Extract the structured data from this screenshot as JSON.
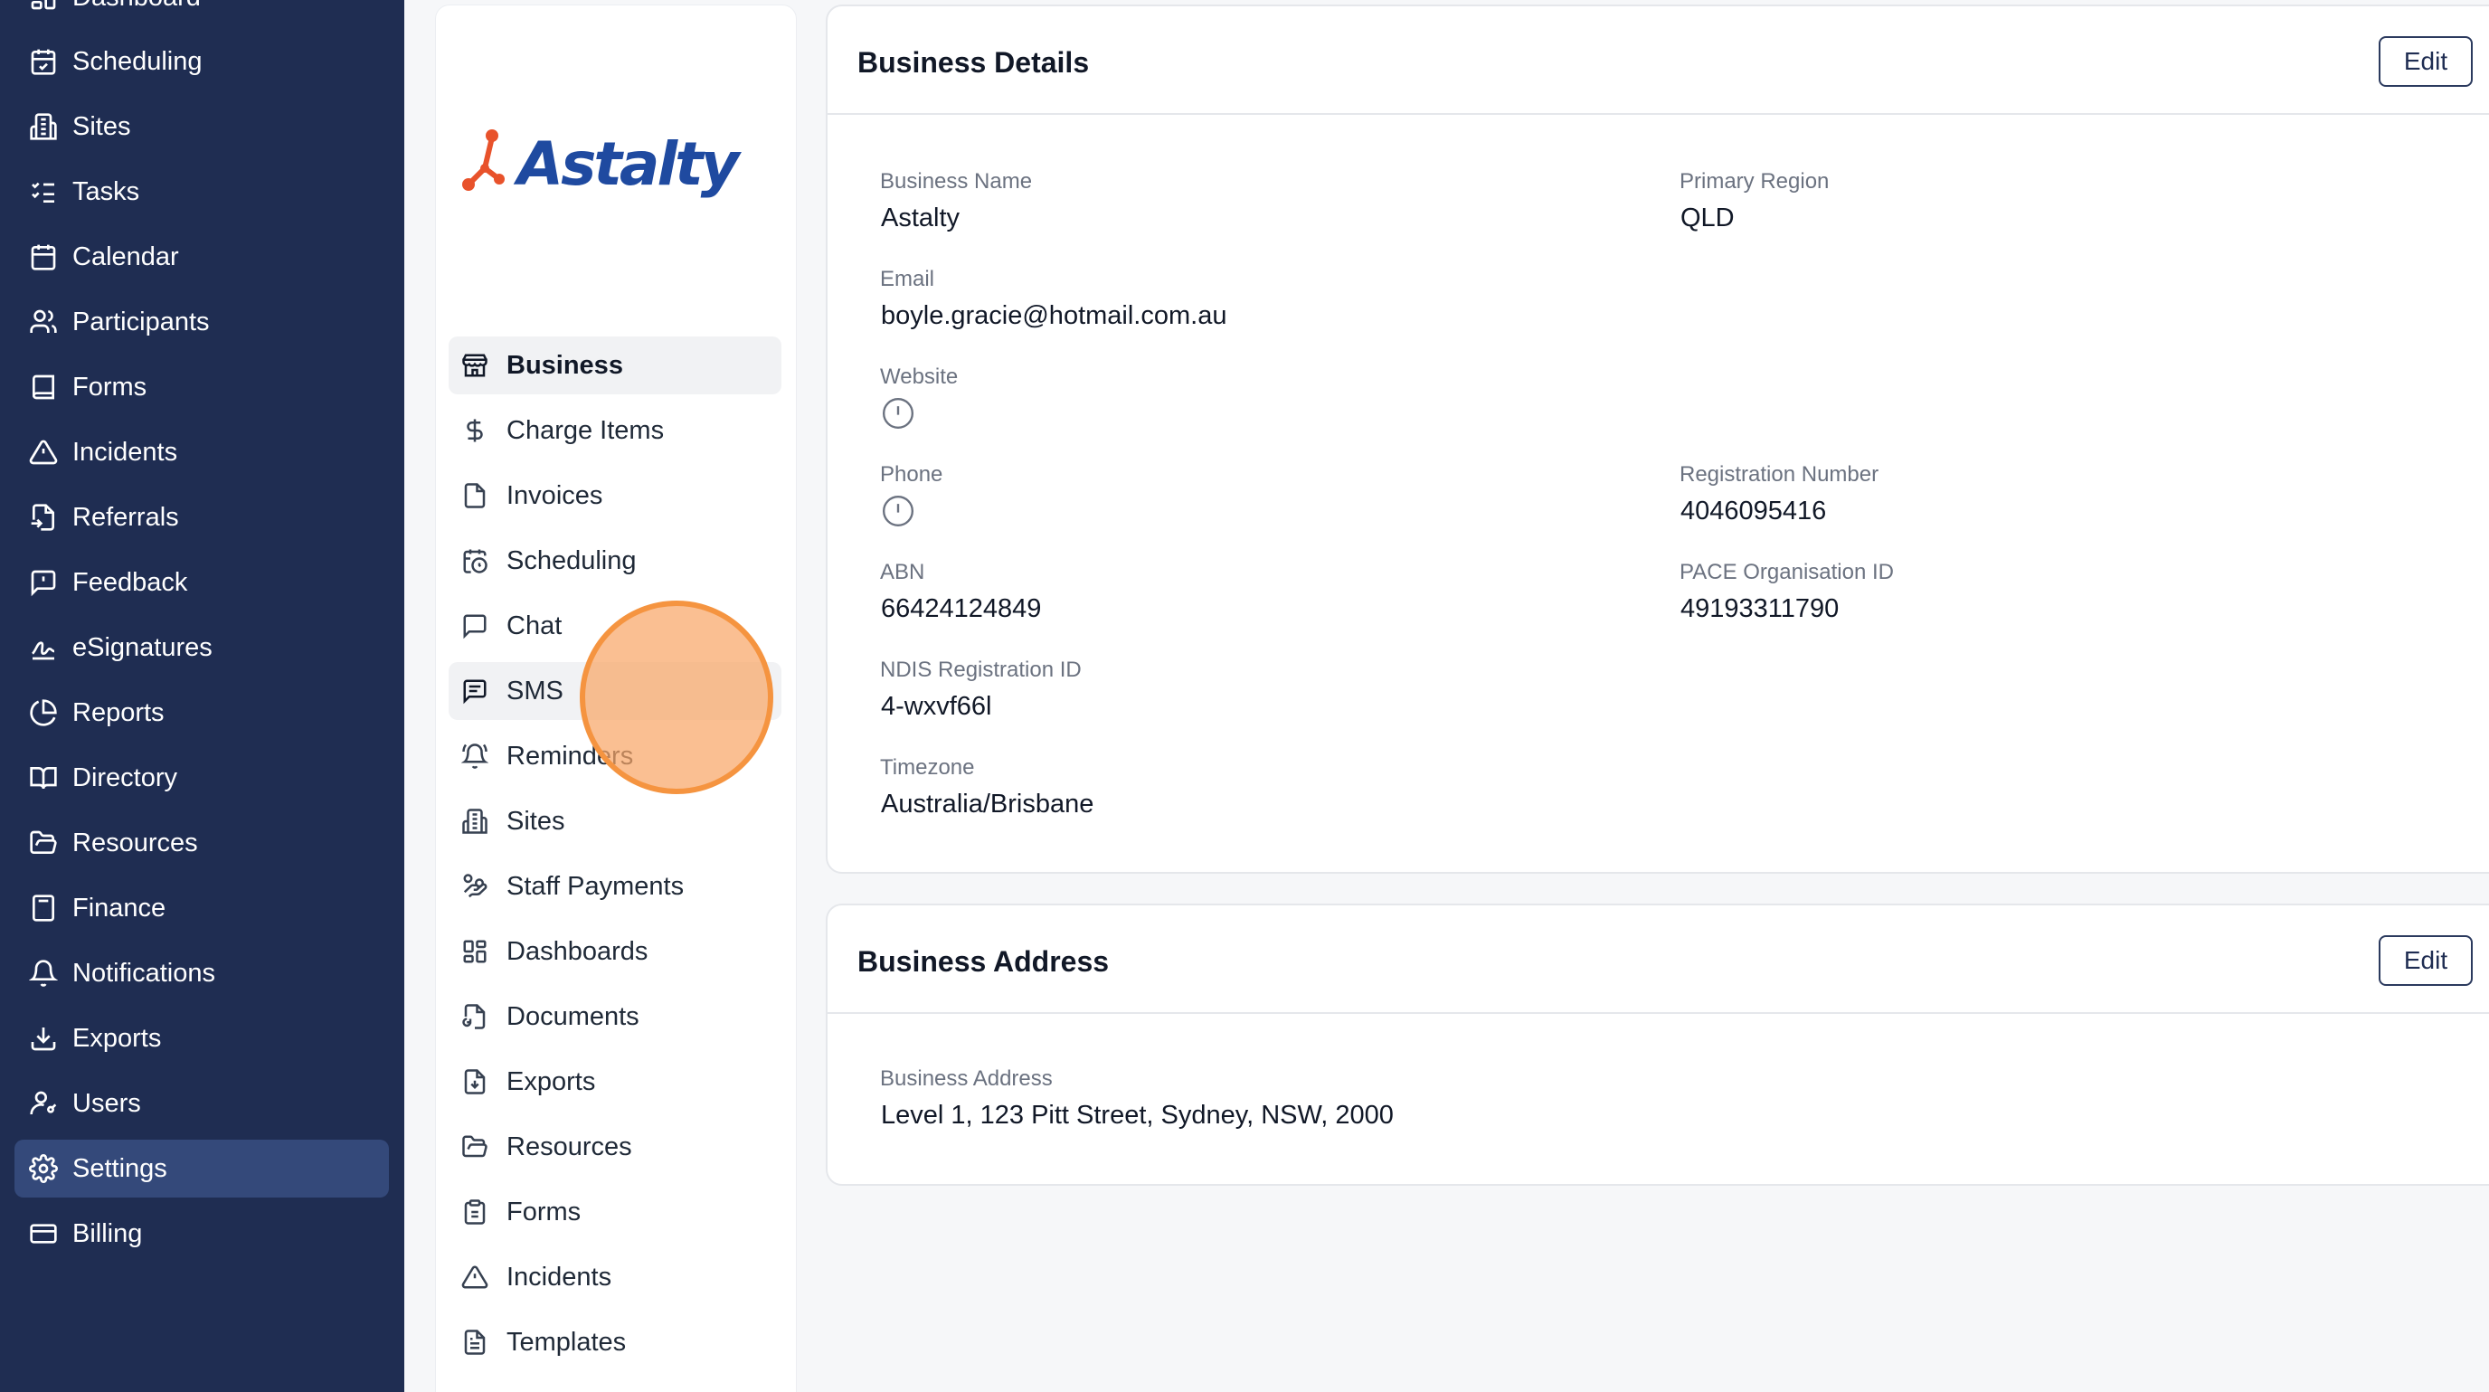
{
  "sidebar": {
    "items": [
      {
        "label": "Dashboard",
        "icon": "dashboard-icon"
      },
      {
        "label": "Scheduling",
        "icon": "calendar-check-icon"
      },
      {
        "label": "Sites",
        "icon": "building-icon"
      },
      {
        "label": "Tasks",
        "icon": "list-checks-icon"
      },
      {
        "label": "Calendar",
        "icon": "calendar-icon"
      },
      {
        "label": "Participants",
        "icon": "users-icon"
      },
      {
        "label": "Forms",
        "icon": "book-icon"
      },
      {
        "label": "Incidents",
        "icon": "warning-triangle-icon"
      },
      {
        "label": "Referrals",
        "icon": "file-import-icon"
      },
      {
        "label": "Feedback",
        "icon": "message-alert-icon"
      },
      {
        "label": "eSignatures",
        "icon": "signature-icon"
      },
      {
        "label": "Reports",
        "icon": "pie-chart-icon"
      },
      {
        "label": "Directory",
        "icon": "book-open-icon"
      },
      {
        "label": "Resources",
        "icon": "folder-open-icon"
      },
      {
        "label": "Finance",
        "icon": "calculator-icon"
      },
      {
        "label": "Notifications",
        "icon": "bell-icon"
      },
      {
        "label": "Exports",
        "icon": "download-icon"
      },
      {
        "label": "Users",
        "icon": "user-key-icon"
      },
      {
        "label": "Settings",
        "icon": "gear-icon",
        "active": true
      },
      {
        "label": "Billing",
        "icon": "credit-card-icon"
      }
    ]
  },
  "settings_nav": {
    "logo_text": "Astalty",
    "items": [
      {
        "label": "Business",
        "icon": "store-icon",
        "active": true
      },
      {
        "label": "Charge Items",
        "icon": "dollar-icon"
      },
      {
        "label": "Invoices",
        "icon": "file-icon"
      },
      {
        "label": "Scheduling",
        "icon": "calendar-clock-icon"
      },
      {
        "label": "Chat",
        "icon": "chat-icon"
      },
      {
        "label": "SMS",
        "icon": "message-text-icon"
      },
      {
        "label": "Reminders",
        "icon": "bell-ring-icon"
      },
      {
        "label": "Sites",
        "icon": "building-icon"
      },
      {
        "label": "Staff Payments",
        "icon": "hand-coins-icon"
      },
      {
        "label": "Dashboards",
        "icon": "dashboard-icon"
      },
      {
        "label": "Documents",
        "icon": "file-sync-icon"
      },
      {
        "label": "Exports",
        "icon": "file-download-icon"
      },
      {
        "label": "Resources",
        "icon": "folder-open-icon"
      },
      {
        "label": "Forms",
        "icon": "clipboard-icon"
      },
      {
        "label": "Incidents",
        "icon": "warning-triangle-icon"
      },
      {
        "label": "Templates",
        "icon": "file-text-icon"
      }
    ]
  },
  "business_details": {
    "title": "Business Details",
    "edit_label": "Edit",
    "fields": {
      "business_name": {
        "label": "Business Name",
        "value": "Astalty"
      },
      "primary_region": {
        "label": "Primary Region",
        "value": "QLD"
      },
      "email": {
        "label": "Email",
        "value": "boyle.gracie@hotmail.com.au"
      },
      "website": {
        "label": "Website",
        "icon": "info-circle-icon"
      },
      "phone": {
        "label": "Phone",
        "icon": "info-circle-icon"
      },
      "registration_number": {
        "label": "Registration Number",
        "value": "4046095416"
      },
      "abn": {
        "label": "ABN",
        "value": "66424124849"
      },
      "pace_id": {
        "label": "PACE Organisation ID",
        "value": "49193311790"
      },
      "ndis_id": {
        "label": "NDIS Registration ID",
        "value": "4-wxvf66l"
      },
      "timezone": {
        "label": "Timezone",
        "value": "Australia/Brisbane"
      }
    }
  },
  "business_address": {
    "title": "Business Address",
    "edit_label": "Edit",
    "address": {
      "label": "Business Address",
      "value": "Level 1, 123 Pitt Street, Sydney, NSW, 2000"
    }
  },
  "colors": {
    "sidebar_bg": "#1f2d52",
    "sidebar_active": "#34497a",
    "logo_orange": "#e8522b",
    "logo_blue": "#1f4aa0",
    "click_indicator": "#f59440"
  }
}
